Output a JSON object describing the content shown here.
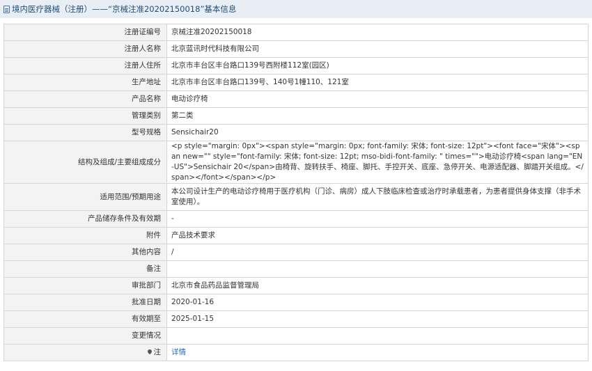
{
  "header": {
    "title": "境内医疗器械（注册）——“京械注准20202150018”基本信息"
  },
  "rows": [
    {
      "label": "注册证编号",
      "value": "京械注准20202150018"
    },
    {
      "label": "注册人名称",
      "value": "北京蓝讯时代科技有限公司"
    },
    {
      "label": "注册人住所",
      "value": "北京市丰台区丰台路口139号西附楼112室(园区)"
    },
    {
      "label": "生产地址",
      "value": "北京市丰台区丰台路口139号、140号1幢110、121室"
    },
    {
      "label": "产品名称",
      "value": "电动诊疗椅"
    },
    {
      "label": "管理类别",
      "value": "第二类"
    },
    {
      "label": "型号规格",
      "value": "Sensichair20"
    },
    {
      "label": "结构及组成/主要组成成分",
      "value": "<p style=\"margin: 0px\"><span style=\"margin: 0px; font-family: 宋体; font-size: 12pt\"><font face=\"宋体\"><span new=\"\" style=\"font-family: 宋体; font-size: 12pt; mso-bidi-font-family: \" times=\"\">电动诊疗椅<span lang=\"EN-US\">Sensichair 20</span>由椅背、旋转扶手、椅座、脚托、手控开关、底座、急停开关、电源适配器、脚踏开关组成。</span></font></span></p>"
    },
    {
      "label": "适用范围/预期用途",
      "value": "本公司设计生产的电动诊疗椅用于医疗机构（门诊、病房）成人下肢临床检查或治疗时承载患者，为患者提供身体支撑（非手术室使用）。"
    },
    {
      "label": "产品储存条件及有效期",
      "value": "-"
    },
    {
      "label": "附件",
      "value": "产品技术要求"
    },
    {
      "label": "其他内容",
      "value": "/"
    },
    {
      "label": "备注",
      "value": ""
    },
    {
      "label": "审批部门",
      "value": "北京市食品药品监督管理局"
    },
    {
      "label": "批准日期",
      "value": "2020-01-16"
    },
    {
      "label": "有效期至",
      "value": "2025-01-15"
    },
    {
      "label": "变更情况",
      "value": ""
    }
  ],
  "note_row": {
    "label": "注",
    "link_text": "详情",
    "icon": "pin-icon"
  },
  "colors": {
    "header_bg": "#e9eef4",
    "header_text": "#1f4e79",
    "label_bg": "#f3f3f3",
    "border": "#d6d6d6",
    "link": "#2a6db5"
  }
}
